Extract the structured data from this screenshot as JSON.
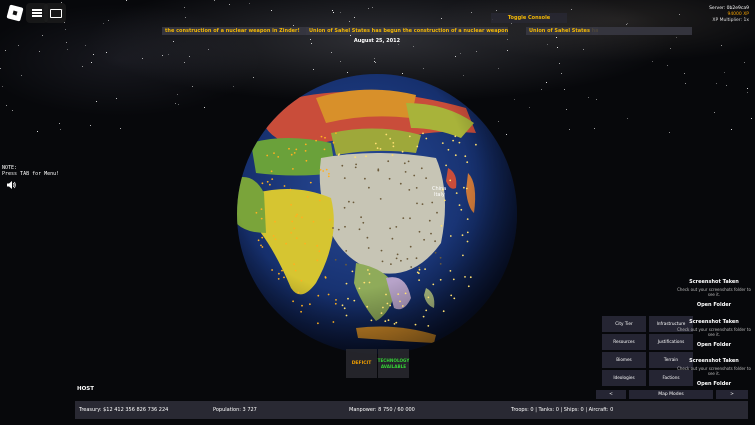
{
  "topbar": {
    "toggle_console": "Toggle Console",
    "server_line": "Server: 0b2e9ca9",
    "xp_line": "94000 XP",
    "mult_line": "XP Multiplier: 1x"
  },
  "tickers": [
    "the construction of a nuclear weapon in Zinder!",
    "Union of Sahel States has begun the construction of a nuclear weapon in Tahoua!",
    "Union of Sahel States has"
  ],
  "date": "August 25, 2012",
  "note": [
    "NOTE:",
    "Press TAB for Menu!"
  ],
  "globe": {
    "labels": [
      "China",
      "Italy"
    ]
  },
  "budget": {
    "deficit": "DEFICIT",
    "tech": [
      "TECHNOLOGY",
      "AVAILABLE"
    ]
  },
  "host_label": "HOST",
  "stats": {
    "treasury": "Treasury:  $12 412 356 826 736 224",
    "population": "Population: 3 727",
    "manpower": "Manpower:  8 750  /  60 000",
    "military": "Troops: 0  |  Tanks: 0  |  Ships: 0  |  Aircraft: 0"
  },
  "screenshots": [
    {
      "title": "Screenshot Taken",
      "desc": "Check out your screenshots folder to see it.",
      "open": "Open Folder"
    },
    {
      "title": "Screenshot Taken",
      "desc": "Check out your screenshots folder to see it.",
      "open": "Open Folder"
    },
    {
      "title": "Screenshot Taken",
      "desc": "Check out your screenshots folder to see it.",
      "open": "Open Folder"
    }
  ],
  "map_modes": {
    "left": [
      "City Tier",
      "Resources",
      "Biomes",
      "Ideologies"
    ],
    "right": [
      "Infrastructure",
      "Justifications",
      "Terrain",
      "Factions"
    ],
    "prev": "<",
    "label": "Map Modes",
    "next": ">"
  }
}
